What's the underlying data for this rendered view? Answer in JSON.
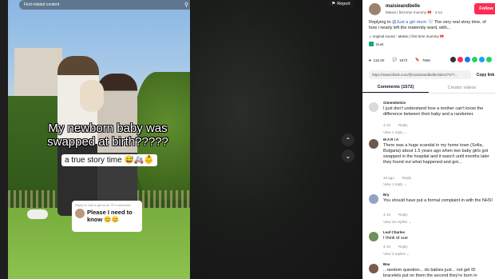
{
  "search": {
    "placeholder": "Find related content"
  },
  "video": {
    "caption_main": "My newborn baby was swapped at birth?????",
    "caption_sub": "a true story time 😅🚑👶",
    "reply_card": {
      "top": "Reply to Just a girl mum 🤍's comment",
      "text": "Please I need to know 😊😊"
    }
  },
  "report_label": "Report",
  "nav": {
    "up": "⌃",
    "down": "⌄"
  },
  "panel": {
    "username": "maisieandbelle",
    "subline": "Maisie | first time mummy 🎀 · 4-14",
    "follow_label": "Follow",
    "description_prefix": "Replying to ",
    "description_tag": "@Just a girl mum 🤍",
    "description_rest": " The very real story time, of how i nearly left the maternity ward, with...",
    "sound": "♫ original sound - Maisie | first time mummy 🎀",
    "duet": "Duet",
    "stats": {
      "likes": "116.2K",
      "comments": "1572",
      "saves": "7666"
    },
    "link": "https://www.tiktok.com/@maisieandbelle/video/7377...",
    "copy_link": "Copy link",
    "tabs": [
      "Comments (1572)",
      "Creator videos"
    ],
    "share_colors": [
      "#333333",
      "#fe2c55",
      "#1877f2",
      "#25d366",
      "#1da1f2",
      "#25d366"
    ]
  },
  "comments": [
    {
      "name": "Gimmebelcie",
      "text": "I just don't understand how a mother can't know the difference between their baby and a randomer.",
      "date": "4-15",
      "reply": "Reply",
      "view": "View 1 reply ⌄"
    },
    {
      "name": "M A R I A",
      "text": "There was a huge scandal in my home town (Sofia, Bulgaria) about 1.5 years ago when two baby girls got swapped in the hospital and it wasn't until months later they found out what happened and got...",
      "date": "4d ago",
      "reply": "Reply",
      "view": "View 1 reply ⌄"
    },
    {
      "name": "Bry",
      "text": "You should have put a formal complaint in with the NHS!",
      "date": "4-15",
      "reply": "Reply",
      "view": "View 26 replies ⌄"
    },
    {
      "name": "Leaf Charles",
      "text": "I think id sue",
      "date": "4-16",
      "reply": "Reply",
      "view": "View 3 replies ⌄"
    },
    {
      "name": "Bea",
      "text": "...random question... do babies just... not get ID bracelets put on them the second they're born in",
      "date": "",
      "reply": "",
      "view": ""
    }
  ]
}
